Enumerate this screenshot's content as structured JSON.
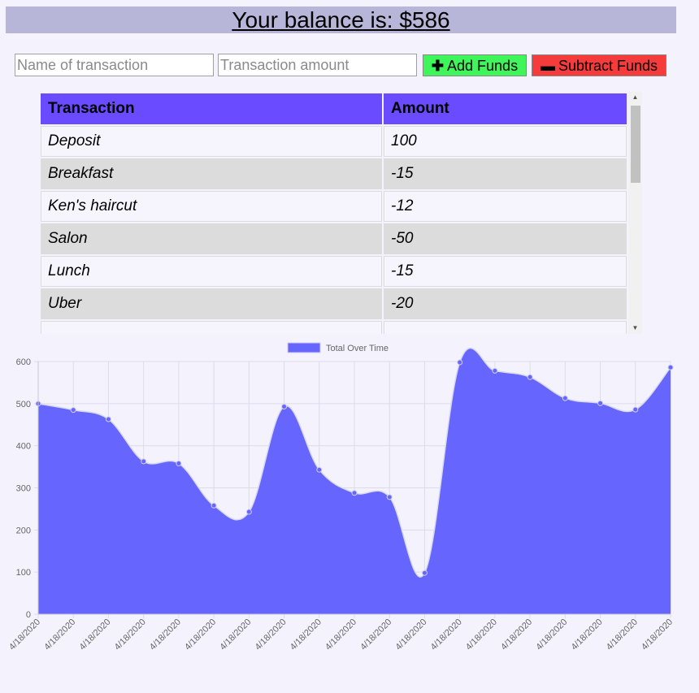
{
  "header": {
    "balance_label": "Your balance is: $586"
  },
  "form": {
    "name_placeholder": "Name of transaction",
    "amount_placeholder": "Transaction amount",
    "add_label": "Add Funds",
    "subtract_label": "Subtract Funds",
    "add_icon": "plus-icon",
    "subtract_icon": "minus-icon"
  },
  "table": {
    "headers": [
      "Transaction",
      "Amount"
    ],
    "rows": [
      {
        "name": "Deposit",
        "amount": "100"
      },
      {
        "name": "Breakfast",
        "amount": "-15"
      },
      {
        "name": "Ken's haircut",
        "amount": "-12"
      },
      {
        "name": "Salon",
        "amount": "-50"
      },
      {
        "name": "Lunch",
        "amount": "-15"
      },
      {
        "name": "Uber",
        "amount": "-20"
      },
      {
        "name": "",
        "amount": ""
      }
    ]
  },
  "colors": {
    "header_bg": "#b7b5d8",
    "table_header": "#6b4bff",
    "add_button": "#3ef55a",
    "subtract_button": "#f53b3b",
    "chart_fill": "#6666ff"
  },
  "chart_data": {
    "type": "area",
    "legend": "Total Over Time",
    "legend_position": "top",
    "ylim": [
      0,
      600
    ],
    "yticks": [
      0,
      100,
      200,
      300,
      400,
      500,
      600
    ],
    "grid": true,
    "x": [
      "4/18/2020",
      "4/18/2020",
      "4/18/2020",
      "4/18/2020",
      "4/18/2020",
      "4/18/2020",
      "4/18/2020",
      "4/18/2020",
      "4/18/2020",
      "4/18/2020",
      "4/18/2020",
      "4/18/2020",
      "4/18/2020",
      "4/18/2020",
      "4/18/2020",
      "4/18/2020",
      "4/18/2020",
      "4/18/2020",
      "4/18/2020"
    ],
    "values": [
      500,
      485,
      463,
      363,
      358,
      258,
      243,
      493,
      343,
      288,
      278,
      98,
      598,
      578,
      563,
      513,
      501,
      486,
      586
    ]
  }
}
